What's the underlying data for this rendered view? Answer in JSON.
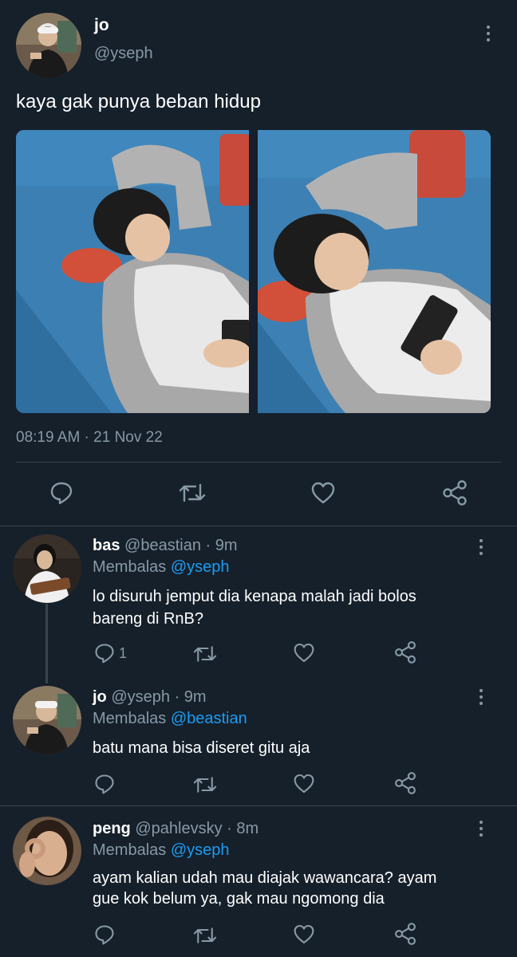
{
  "main_tweet": {
    "display_name": "jo",
    "handle": "@yseph",
    "text": "kaya gak punya beban hidup",
    "timestamp": "08:19 AM · 21 Nov 22",
    "actions": [
      "reply-icon",
      "retweet-icon",
      "like-icon",
      "share-icon"
    ]
  },
  "replies": [
    {
      "display_name": "bas",
      "handle": "@beastian",
      "time": "· 9m",
      "replying_prefix": "Membalas",
      "replying_to": "@yseph",
      "text_lines": [
        "lo disuruh jemput dia kenapa malah jadi bolos",
        "bareng di RnB?"
      ],
      "reply_count": "1"
    },
    {
      "display_name": "jo",
      "handle": "@yseph",
      "time": "· 9m",
      "replying_prefix": "Membalas",
      "replying_to": "@beastian",
      "text_lines": [
        "batu mana bisa diseret gitu aja"
      ],
      "reply_count": ""
    },
    {
      "display_name": "peng",
      "handle": "@pahlevsky",
      "time": "· 8m",
      "replying_prefix": "Membalas",
      "replying_to": "@yseph",
      "text_lines": [
        "ayam kalian udah mau diajak wawancara? ayam",
        "gue kok belum ya, gak mau ngomong dia"
      ],
      "reply_count": ""
    }
  ],
  "colors": {
    "background": "#15202b",
    "text": "#ffffff",
    "muted": "#8899a6",
    "link": "#1d9bf0",
    "divider": "#38444d"
  }
}
